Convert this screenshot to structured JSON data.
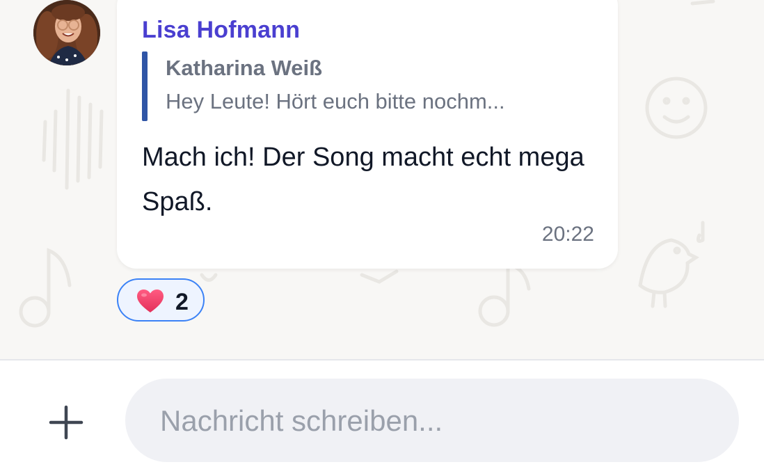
{
  "message": {
    "sender_name": "Lisa Hofmann",
    "avatar_alt": "Lisa Hofmann avatar",
    "reply": {
      "author": "Katharina Weiß",
      "excerpt": "Hey Leute! Hört euch bitte nochm..."
    },
    "text": "Mach ich! Der Song macht echt mega Spaß.",
    "time": "20:22",
    "reaction": {
      "emoji_icon": "heart-icon",
      "count": "2"
    }
  },
  "composer": {
    "placeholder": "Nachricht schreiben...",
    "value": "",
    "add_icon": "plus-icon"
  },
  "colors": {
    "sender_name": "#4a3fd0",
    "quote_bar": "#2f55a6",
    "reaction_border": "#3b82f6",
    "heart": "#f0436b",
    "input_bg": "#f0f1f5",
    "chat_bg": "#f8f7f5"
  }
}
